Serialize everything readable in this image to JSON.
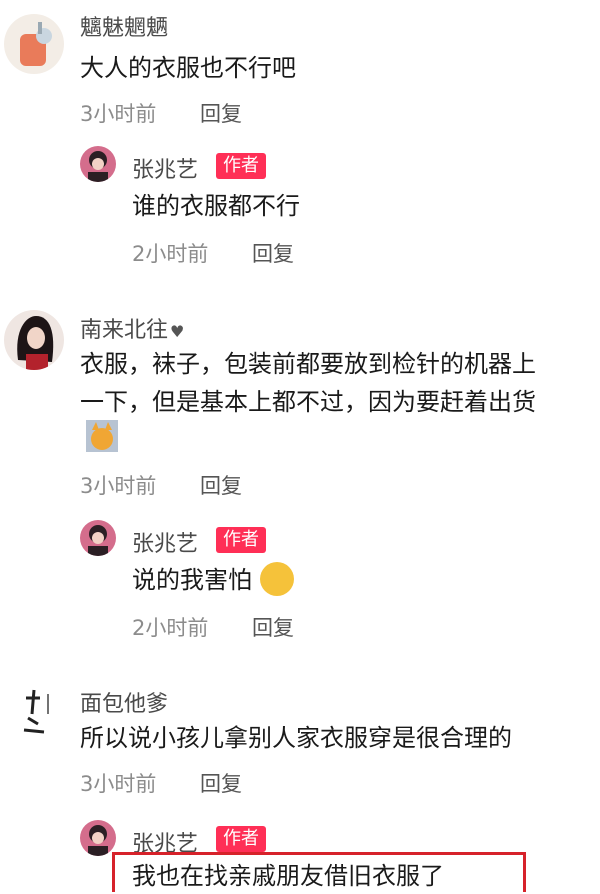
{
  "comments": [
    {
      "user": "魑魅魍魉",
      "text": "大人的衣服也不行吧",
      "time": "3小时前",
      "reply_label": "回复",
      "reply": {
        "user": "张兆艺",
        "badge": "作者",
        "text": "谁的衣服都不行",
        "time": "2小时前",
        "reply_label": "回复"
      }
    },
    {
      "user": "南来北往",
      "heart": "♥",
      "text_line1": "衣服，袜子，包装前都要放到检针的机器上",
      "text_line2": "一下，但是基本上都不过，因为要赶着出货",
      "time": "3小时前",
      "reply_label": "回复",
      "reply": {
        "user": "张兆艺",
        "badge": "作者",
        "text": "说的我害怕",
        "time": "2小时前",
        "reply_label": "回复"
      }
    },
    {
      "user": "面包他爹",
      "text": "所以说小孩儿拿别人家衣服穿是很合理的",
      "time": "3小时前",
      "reply_label": "回复",
      "reply": {
        "user": "张兆艺",
        "badge": "作者",
        "text": "我也在找亲戚朋友借旧衣服了"
      }
    }
  ],
  "colors": {
    "badge": "#ff2f56",
    "highlight": "#d6222a"
  }
}
